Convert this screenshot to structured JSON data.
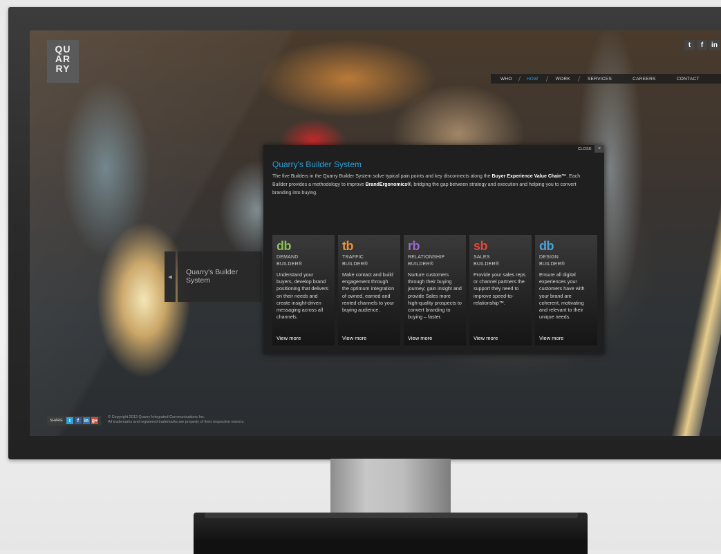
{
  "logo": {
    "lines": [
      "QU",
      "AR",
      "RY"
    ]
  },
  "social": [
    {
      "icon": "twitter-icon",
      "glyph": "t",
      "color": "#2aa3dc"
    },
    {
      "icon": "facebook-icon",
      "glyph": "f",
      "color": "#3b5a99"
    },
    {
      "icon": "linkedin-icon",
      "glyph": "in",
      "color": "#2a77b4"
    }
  ],
  "nav": {
    "items": [
      "WHO",
      "HOW",
      "WORK",
      "SERVICES",
      "CAREERS",
      "CONTACT"
    ],
    "active": "HOW"
  },
  "side_tab": {
    "label": "Quarry's Builder System"
  },
  "modal": {
    "close_label": "CLOSE",
    "close_glyph": "×",
    "title": "Quarry's Builder System",
    "desc": {
      "p1": "The five Builders in the Quarry Builder System solve typical pain points and key disconnects along the ",
      "b1": "Buyer Experience Value Chain™",
      "p2": ". Each Builder provides a methodology to improve ",
      "b2": "BrandErgonomics®",
      "p3": ", bridging the gap between strategy and execution and helping you to convert branding into buying."
    },
    "cards": [
      {
        "abbr": "db",
        "color": "#8fbf5a",
        "name1": "DEMAND",
        "name2": "BUILDER®",
        "desc": "Understand your buyers, develop brand positioning that delivers on their needs and create insight-driven messaging across all channels.",
        "more": "View more"
      },
      {
        "abbr": "tb",
        "color": "#e8923a",
        "name1": "TRAFFIC",
        "name2": "BUILDER®",
        "desc": "Make contact and build engagement through the optimum integration of owned, earned and rented channels to your buying audience.",
        "more": "View more"
      },
      {
        "abbr": "rb",
        "color": "#9b6ac9",
        "name1": "RELATIONSHIP",
        "name2": "BUILDER®",
        "desc": "Nurture customers through their buying journey; gain insight and provide Sales more high-quality prospects to convert branding to buying – faster.",
        "more": "View more"
      },
      {
        "abbr": "sb",
        "color": "#e04a3a",
        "name1": "SALES",
        "name2": "BUILDER®",
        "desc": "Provide your sales reps or channel partners the support they need to improve speed-to-relationship™.",
        "more": "View more"
      },
      {
        "abbr": "db",
        "color": "#4aa3d8",
        "name1": "DESIGN",
        "name2": "BUILDER®",
        "desc": "Ensure all digital experiences your customers have with your brand are coherent, motivating and relevant to their unique needs.",
        "more": "View more"
      }
    ]
  },
  "footer": {
    "share_label": "SHARE",
    "share_icons": [
      {
        "icon": "twitter-icon",
        "glyph": "t",
        "color": "#2aa3dc"
      },
      {
        "icon": "facebook-icon",
        "glyph": "f",
        "color": "#3b5a99"
      },
      {
        "icon": "linkedin-icon",
        "glyph": "in",
        "color": "#2a77b4"
      },
      {
        "icon": "google-plus-icon",
        "glyph": "g+",
        "color": "#d34836"
      }
    ],
    "copyright1": "© Copyright 2012 Quarry Integrated Communications Inc.",
    "copyright2": "All trademarks and registered trademarks are property of their respective owners."
  }
}
